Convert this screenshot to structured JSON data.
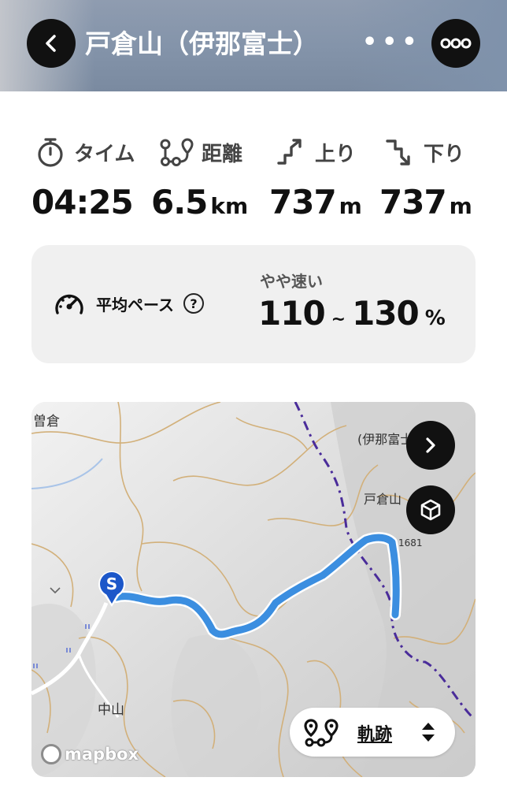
{
  "header": {
    "title": "戸倉山（伊那富士）",
    "ellipsis": "•••",
    "back_icon": "chevron-left-icon",
    "more_icon": "more-dots-icon"
  },
  "stats": {
    "time": {
      "label": "タイム",
      "value": "04:25",
      "unit": ""
    },
    "distance": {
      "label": "距離",
      "value": "6.5",
      "unit": "km"
    },
    "ascent": {
      "label": "上り",
      "value": "737",
      "unit": "m"
    },
    "descent": {
      "label": "下り",
      "value": "737",
      "unit": "m"
    }
  },
  "pace": {
    "label": "平均ペース",
    "help": "?",
    "tag": "やや速い",
    "min": "110",
    "tilde": "~",
    "max": "130",
    "unit": "%"
  },
  "map": {
    "labels": {
      "top_left": "曽倉",
      "ina_fuji": "(伊那富士",
      "tokura": "戸倉山",
      "elevation": "1681",
      "nakayama": "中山"
    },
    "start_marker": "S",
    "attribution": "mapbox",
    "track_toggle_label": "軌跡",
    "track_color": "#3b8ee0",
    "trail_color": "#4a2c9a",
    "contour_color": "#d2b07a"
  }
}
